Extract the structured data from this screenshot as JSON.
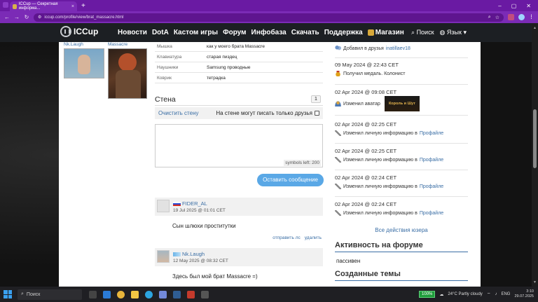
{
  "browser": {
    "tab_title": "ICCup — Секретная информа...",
    "url": "iccup.com/profile/view/brat_massacre.html"
  },
  "site": {
    "logo": "ICCup",
    "menu": [
      "Новости",
      "DotA",
      "Кастом игры",
      "Форум",
      "Инфобаза",
      "Скачать",
      "Поддержка"
    ],
    "shop": "Магазин",
    "search": "Поиск",
    "language": "Язык"
  },
  "profile": {
    "friend1_label": "Nk.Laugh",
    "friend2_label": "Massacre",
    "props": [
      {
        "k": "Мышка",
        "v": "как у моего брата Massacre"
      },
      {
        "k": "Клавиатура",
        "v": "старая пиздец"
      },
      {
        "k": "Наушники",
        "v": "Samsung проводные"
      },
      {
        "k": "Коврик",
        "v": "тетрадка"
      }
    ]
  },
  "wall": {
    "title": "Стена",
    "page": "1",
    "clear": "Очистить стену",
    "friends_only": "На стене могут писать только друзья",
    "symbols_left": "symbols left: 200",
    "send": "Оставить сообщение",
    "posts": [
      {
        "name": "FIDER_AL",
        "date": "19 Jul 2025 @ 01:01 CET",
        "text": "Сын шлюхи проститутки",
        "actions": [
          "отправить лс",
          "удалить"
        ]
      },
      {
        "name": "Nk.Laugh",
        "date": "12 May 2025 @ 08:32 CET",
        "text": "Здесь был мой брат Massacre =)"
      }
    ]
  },
  "activity": {
    "items": [
      {
        "date": "",
        "text": "Добавил в друзья",
        "link": "inatillaev18",
        "icon": "friends-icon"
      },
      {
        "date": "09 May 2024 @ 22:43 CET",
        "text": "Получил медаль. Колонист",
        "link": "",
        "icon": "medal-icon"
      },
      {
        "date": "02 Apr 2024 @ 09:08 CET",
        "text": "Изменил аватар",
        "link": "",
        "icon": "user-icon",
        "avatar_text": "Король и Шут"
      },
      {
        "date": "02 Apr 2024 @ 02:25 CET",
        "text": "Изменил личную информацию в",
        "link": "Профайле",
        "icon": "wrench-icon"
      },
      {
        "date": "02 Apr 2024 @ 02:25 CET",
        "text": "Изменил личную информацию в",
        "link": "Профайле",
        "icon": "wrench-icon"
      },
      {
        "date": "02 Apr 2024 @ 02:24 CET",
        "text": "Изменил личную информацию в",
        "link": "Профайле",
        "icon": "wrench-icon"
      },
      {
        "date": "02 Apr 2024 @ 02:24 CET",
        "text": "Изменил личную информацию в",
        "link": "Профайле",
        "icon": "wrench-icon"
      }
    ],
    "all": "Все действия юзера",
    "forum_title": "Активность на форуме",
    "forum_value": "пассивен",
    "topics_title": "Созданные темы"
  },
  "taskbar": {
    "search": "Поиск",
    "battery": "100%",
    "weather": "24°C  Partly cloudy",
    "lang": "ENG",
    "time": "3:10",
    "date": "29.07.2025"
  }
}
